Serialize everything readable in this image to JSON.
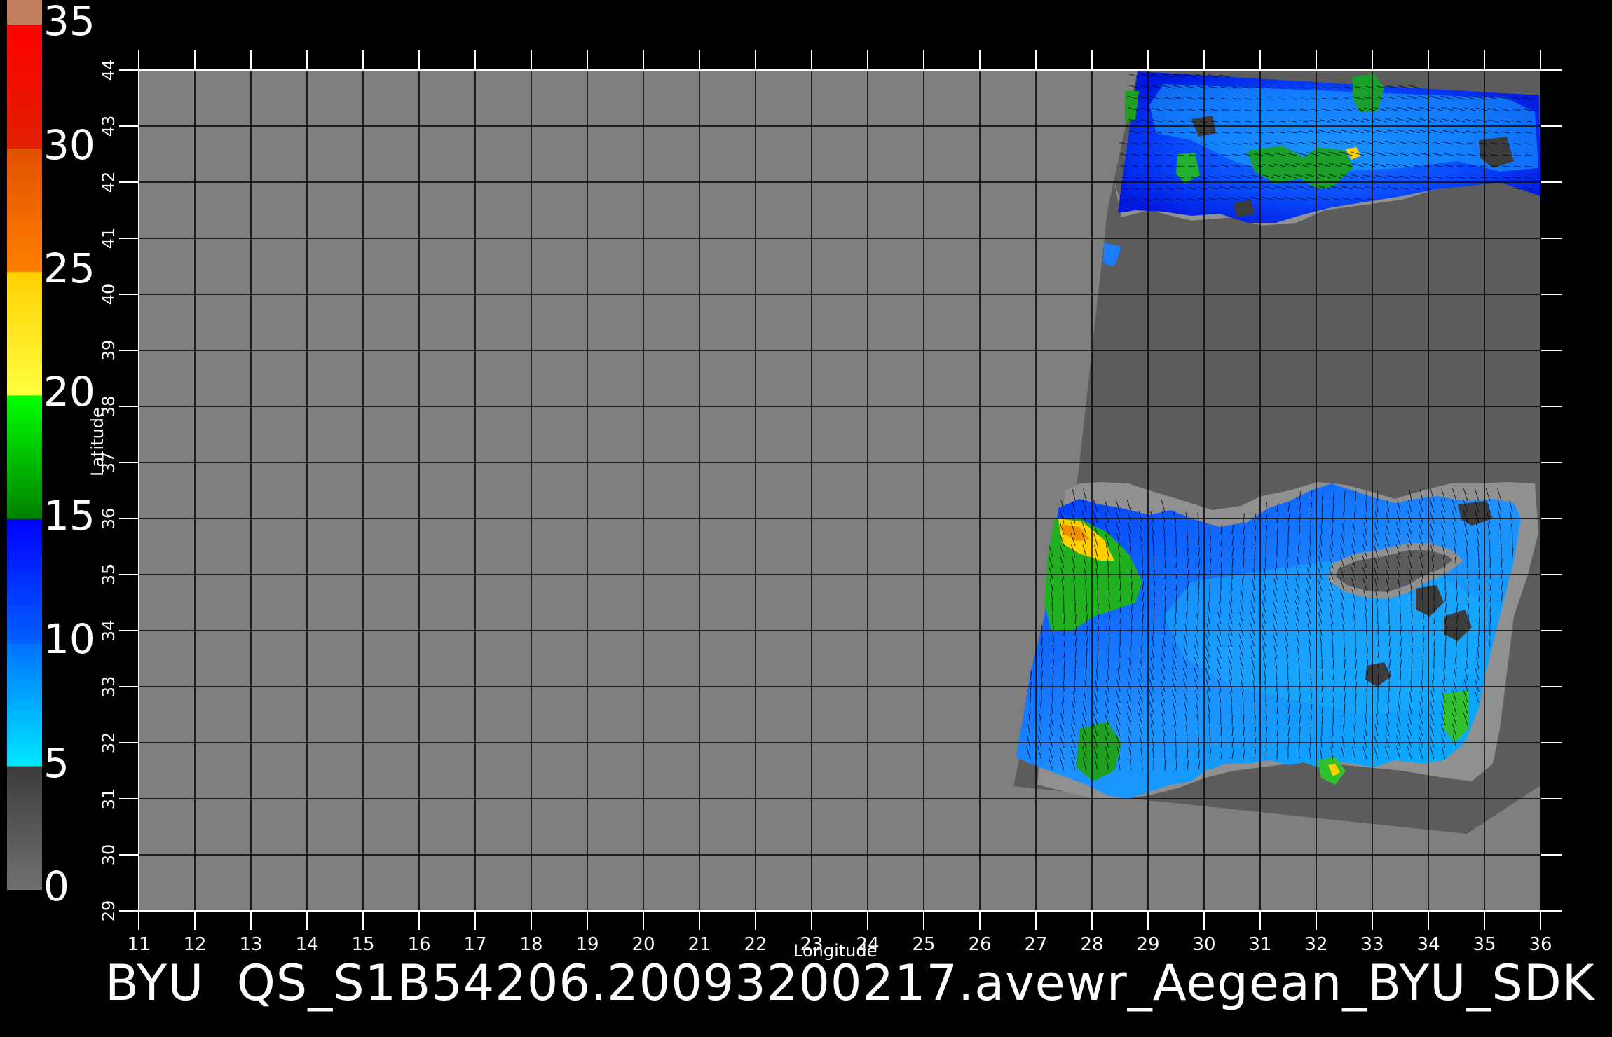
{
  "title": "BYU  QS_S1B54206.20093200217.avewr_Aegean_BYU_SDK",
  "axes": {
    "xlabel": "Longitude",
    "ylabel": "Latitude",
    "x_ticks": [
      "11",
      "12",
      "13",
      "14",
      "15",
      "16",
      "17",
      "18",
      "19",
      "20",
      "21",
      "22",
      "23",
      "24",
      "25",
      "26",
      "27",
      "28",
      "29",
      "30",
      "31",
      "32",
      "33",
      "34",
      "35",
      "36"
    ],
    "y_ticks": [
      "29",
      "30",
      "31",
      "32",
      "33",
      "34",
      "35",
      "36",
      "37",
      "38",
      "39",
      "40",
      "41",
      "42",
      "43",
      "44"
    ],
    "x_range": [
      11,
      36
    ],
    "y_range": [
      29,
      44
    ]
  },
  "colorbar": {
    "labels": [
      "35",
      "30",
      "25",
      "20",
      "15",
      "10",
      "5",
      "0"
    ],
    "bands": [
      {
        "from": 0,
        "to": 5,
        "colors": [
          "#707070",
          "#3c3c3c"
        ]
      },
      {
        "from": 5,
        "to": 10,
        "colors": [
          "#00e8ff",
          "#0070ff"
        ]
      },
      {
        "from": 10,
        "to": 15,
        "colors": [
          "#0060ff",
          "#0000ff"
        ]
      },
      {
        "from": 15,
        "to": 20,
        "colors": [
          "#008000",
          "#00ff00"
        ]
      },
      {
        "from": 20,
        "to": 25,
        "colors": [
          "#ffff40",
          "#ffd000"
        ]
      },
      {
        "from": 25,
        "to": 30,
        "colors": [
          "#ff8000",
          "#e05000"
        ]
      },
      {
        "from": 30,
        "to": 35,
        "colors": [
          "#e02000",
          "#ff0000"
        ]
      },
      {
        "from": 35,
        "to": 36,
        "colors": [
          "#c08060",
          "#c08060"
        ]
      }
    ]
  },
  "colors": {
    "background": "#000000",
    "nodata": "#7f7f7f",
    "swath_land": "#5c5c5c",
    "coast_buffer": "#909090",
    "grid": "#000000"
  },
  "swath": {
    "corners_lonlat": [
      [
        28.9,
        44.0
      ],
      [
        35.99,
        43.6
      ],
      [
        35.99,
        30.3
      ],
      [
        34.5,
        29.6
      ],
      [
        26.5,
        30.4
      ],
      [
        26.8,
        31.3
      ],
      [
        28.6,
        40.3
      ]
    ]
  }
}
